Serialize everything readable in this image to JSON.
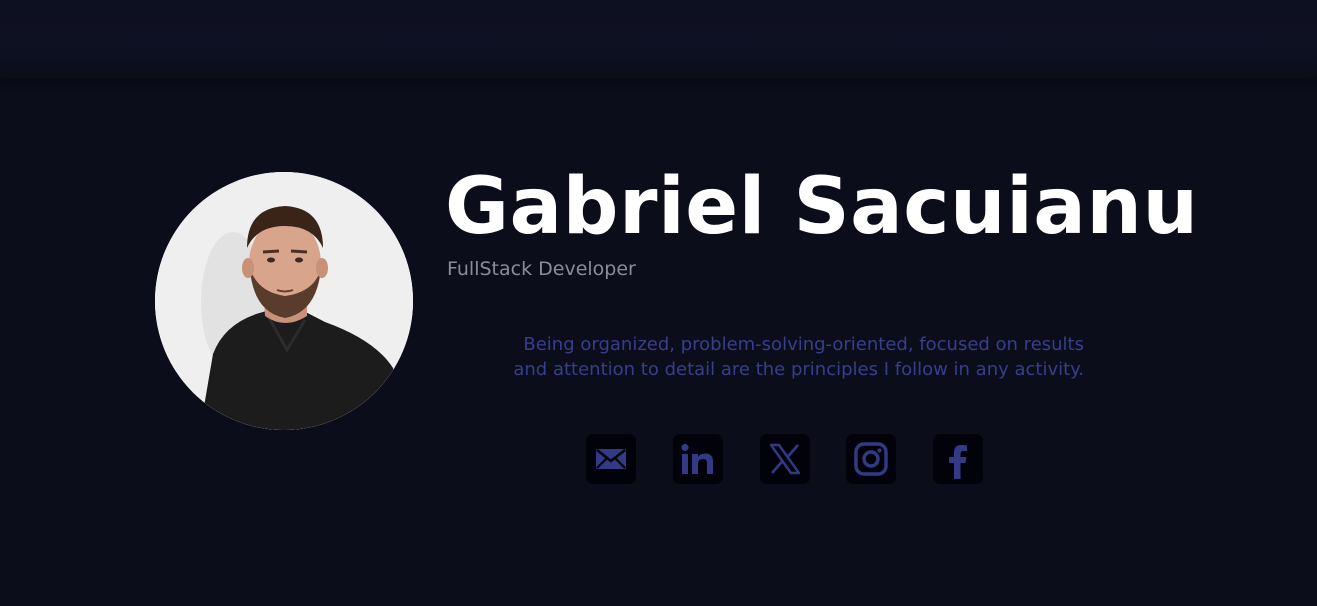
{
  "profile": {
    "name": "Gabriel Sacuianu",
    "role": "FullStack Developer",
    "bio": "Being organized, problem-solving-oriented, focused on results and attention to detail are the principles I follow in any activity."
  },
  "social": [
    {
      "name": "email",
      "icon": "email-icon"
    },
    {
      "name": "linkedin",
      "icon": "linkedin-icon"
    },
    {
      "name": "x",
      "icon": "x-icon"
    },
    {
      "name": "instagram",
      "icon": "instagram-icon"
    },
    {
      "name": "facebook",
      "icon": "facebook-icon"
    }
  ],
  "colors": {
    "background": "#0b0d1b",
    "name": "#ffffff",
    "role": "#8a8d99",
    "bio": "#353f8c",
    "icon_tile": "#02030a",
    "icon_glyph": "#323a86"
  }
}
